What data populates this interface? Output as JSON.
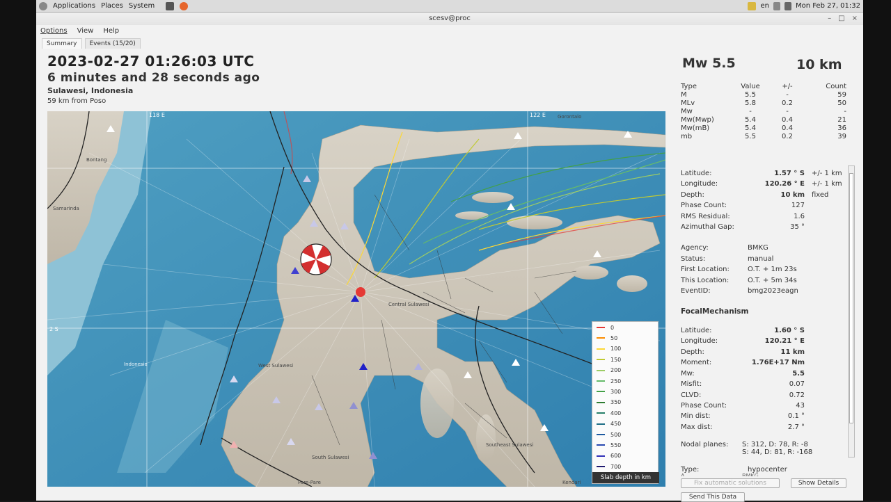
{
  "panel": {
    "menus": [
      "Applications",
      "Places",
      "System"
    ],
    "locale": "en",
    "clock": "Mon Feb 27, 01:32"
  },
  "window": {
    "title": "scesv@proc"
  },
  "menubar": [
    "Options",
    "View",
    "Help"
  ],
  "tabs": [
    "Summary",
    "Events (15/20)"
  ],
  "header": {
    "time": "2023-02-27 01:26:03 UTC",
    "ago": "6 minutes and 28 seconds ago",
    "region": "Sulawesi, Indonesia",
    "near": "59 km from Poso"
  },
  "map": {
    "labels": {
      "lon_118": "118 E",
      "lon_122": "122 E",
      "lat_2_5": "2 S",
      "gorontalo": "Gorontalo",
      "bontang": "Bontang",
      "samarinda": "Samarinda",
      "indonesia": "Indonesia",
      "west_sulawesi": "West Sulawesi",
      "central_sulawesi": "Central Sulawesi",
      "south_sulawesi": "South Sulawesi",
      "southeast_sulawesi": "Southeast Sulawesi",
      "kendari": "Kendari",
      "makassar": "Pare-Pare"
    },
    "legend": {
      "title": "Slab depth in km",
      "items": [
        {
          "label": "0",
          "color": "#e53935"
        },
        {
          "label": "50",
          "color": "#fb8c00"
        },
        {
          "label": "100",
          "color": "#fdd835"
        },
        {
          "label": "150",
          "color": "#c0ca33"
        },
        {
          "label": "200",
          "color": "#9ccc65"
        },
        {
          "label": "250",
          "color": "#66bb6a"
        },
        {
          "label": "300",
          "color": "#43a047"
        },
        {
          "label": "350",
          "color": "#2e7d32"
        },
        {
          "label": "400",
          "color": "#26806a"
        },
        {
          "label": "450",
          "color": "#1e6e86"
        },
        {
          "label": "500",
          "color": "#1e5aa0"
        },
        {
          "label": "550",
          "color": "#2848b0"
        },
        {
          "label": "600",
          "color": "#3030b8"
        },
        {
          "label": "700",
          "color": "#201a70"
        }
      ]
    }
  },
  "magnitude": {
    "main": "Mw 5.5",
    "depth": "10 km",
    "headers": [
      "Type",
      "Value",
      "+/-",
      "Count"
    ],
    "rows": [
      [
        "M",
        "5.5",
        "-",
        "59"
      ],
      [
        "MLv",
        "5.8",
        "0.2",
        "50"
      ],
      [
        "Mw",
        "-",
        "-",
        "-"
      ],
      [
        "Mw(Mwp)",
        "5.4",
        "0.4",
        "21"
      ],
      [
        "Mw(mB)",
        "5.4",
        "0.4",
        "36"
      ],
      [
        "mb",
        "5.5",
        "0.2",
        "39"
      ]
    ]
  },
  "origin": {
    "latitude_label": "Latitude:",
    "latitude": "1.57 ° S",
    "latitude_unc": "+/-   1 km",
    "longitude_label": "Longitude:",
    "longitude": "120.26 ° E",
    "longitude_unc": "+/-   1 km",
    "depth_label": "Depth:",
    "depth": "10 km",
    "depth_type": "fixed",
    "phase_label": "Phase Count:",
    "phase": "127",
    "rms_label": "RMS Residual:",
    "rms": "1.6",
    "gap_label": "Azimuthal Gap:",
    "gap": "35 °",
    "agency_label": "Agency:",
    "agency": "BMKG",
    "status_label": "Status:",
    "status": "manual",
    "first_label": "First Location:",
    "first": "O.T. + 1m 23s",
    "this_label": "This Location:",
    "this": "O.T. + 5m 34s",
    "event_label": "EventID:",
    "event": "bmg2023eagn"
  },
  "focal": {
    "title": "FocalMechanism",
    "latitude_label": "Latitude:",
    "latitude": "1.60 ° S",
    "longitude_label": "Longitude:",
    "longitude": "120.21 ° E",
    "depth_label": "Depth:",
    "depth": "11 km",
    "moment_label": "Moment:",
    "moment": "1.76E+17 Nm",
    "mw_label": "Mw:",
    "mw": "5.5",
    "misfit_label": "Misfit:",
    "misfit": "0.07",
    "clvd_label": "CLVD:",
    "clvd": "0.72",
    "phase_label": "Phase Count:",
    "phase": "43",
    "mindist_label": "Min dist:",
    "mindist": "0.1 °",
    "maxdist_label": "Max dist:",
    "maxdist": "2.7 °",
    "nodal_label": "Nodal planes:",
    "nodal1": "S: 312, D: 78, R: -8",
    "nodal2": "S: 44, D: 81, R: -168",
    "type_label": "Type:",
    "type": "hypocenter",
    "cut_label": "A...",
    "cut_value": "BMKG"
  },
  "buttons": {
    "fix": "Fix automatic solutions",
    "details": "Show Details",
    "send": "Send This Data"
  }
}
